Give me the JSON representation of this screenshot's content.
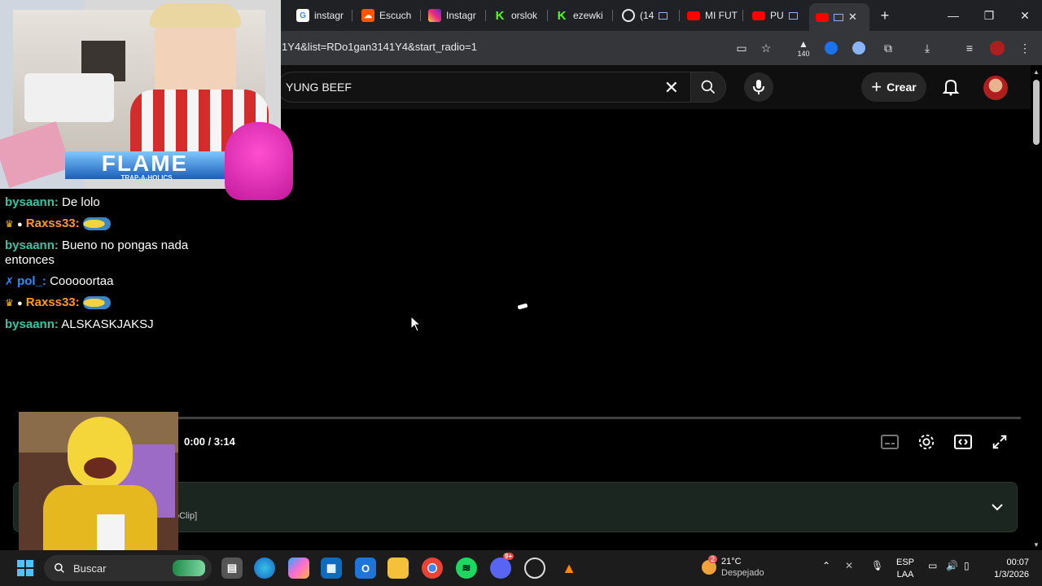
{
  "browser": {
    "tabs": [
      {
        "label": "instagr",
        "favicon": "google-icon"
      },
      {
        "label": "Escuch",
        "favicon": "soundcloud-icon"
      },
      {
        "label": "Instagr",
        "favicon": "instagram-icon"
      },
      {
        "label": "orslok",
        "favicon": "kick-icon"
      },
      {
        "label": "ezewki",
        "favicon": "kick-icon"
      },
      {
        "label": "(14",
        "favicon": "whatsapp-icon"
      },
      {
        "label": "MI FUT",
        "favicon": "youtube-icon"
      },
      {
        "label": "PU",
        "favicon": "youtube-icon"
      },
      {
        "label": "",
        "favicon": "youtube-icon",
        "active": true
      }
    ],
    "url": "1Y4&list=RDo1gan3141Y4&start_radio=1",
    "extension_badge": "140"
  },
  "youtube": {
    "search_query": "YUNG BEEF",
    "create_label": "Crear",
    "time": "0:00 / 3:14",
    "description_suffix": "oClip]"
  },
  "chat": {
    "messages": [
      {
        "user": "bysaann",
        "text": "De lolo",
        "color": "#39c3a4",
        "badges": []
      },
      {
        "user": "Raxss33",
        "text": "",
        "color": "#ff9a1e",
        "badges": [
          "crown-icon",
          "mafia-icon"
        ],
        "emote": "minion-emote"
      },
      {
        "user": "bysaann",
        "text": "Bueno no pongas nada entonces",
        "color": "#39c3a4",
        "badges": []
      },
      {
        "user": "pol_",
        "text": "Cooooortaa",
        "color": "#2f8cff",
        "badges": [
          "sword-icon"
        ]
      },
      {
        "user": "Raxss33",
        "text": "",
        "color": "#ff9a1e",
        "badges": [
          "crown-icon",
          "mafia-icon"
        ],
        "emote": "minion-emote"
      },
      {
        "user": "bysaann",
        "text": "ALSKASKJAKSJ",
        "color": "#39c3a4",
        "badges": []
      }
    ],
    "overlay_logo": "FLAME",
    "overlay_logo_sub": "TRAP-A-HOLICS"
  },
  "taskbar": {
    "search_placeholder": "Buscar",
    "weather_temp": "21°C",
    "weather_desc": "Despejado",
    "weather_badge": "2",
    "lang_top": "ESP",
    "lang_bottom": "LAA",
    "time": "00:07",
    "date": "1/3/2026",
    "discord_badge": "9+"
  },
  "colors": {
    "tabstrip": "#202124",
    "toolbar": "#35363a",
    "youtube_bg": "#0f0f0f",
    "description_bg": "#1a261f",
    "taskbar": "#1c1c1c"
  }
}
